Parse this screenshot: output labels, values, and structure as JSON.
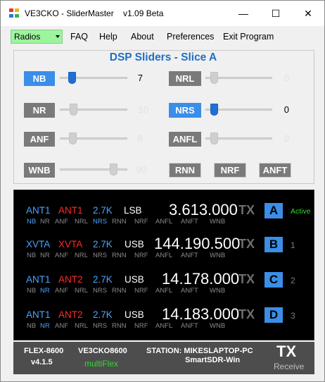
{
  "window": {
    "title": "VE3CKO - SliderMaster    v1.09 Beta",
    "minimize_glyph": "—",
    "maximize_glyph": "☐",
    "close_glyph": "✕"
  },
  "menu": {
    "radios_value": "Radios",
    "items": [
      "FAQ",
      "Help",
      "About",
      "Preferences",
      "Exit Program"
    ]
  },
  "dsp": {
    "title": "DSP Sliders - Slice A",
    "left": [
      {
        "label": "NB",
        "value": "7",
        "active": true,
        "level": 0.07
      },
      {
        "label": "NR",
        "value": "10",
        "active": false,
        "level": 0.1
      },
      {
        "label": "ANF",
        "value": "8",
        "active": false,
        "level": 0.08
      },
      {
        "label": "WNB",
        "value": "90",
        "active": false,
        "level": 0.9
      }
    ],
    "right": [
      {
        "label": "NRL",
        "value": "0",
        "active": false,
        "level": 0
      },
      {
        "label": "NRS",
        "value": "0",
        "active": true,
        "level": 0
      },
      {
        "label": "ANFL",
        "value": "0",
        "active": false,
        "level": 0
      }
    ],
    "extra_buttons": [
      "RNN",
      "NRF",
      "ANFT"
    ]
  },
  "slices": [
    {
      "ant_rx": "ANT1",
      "ant_tx": "ANT1",
      "bw": "2.7K",
      "mode": "LSB",
      "freq": "3.613.000",
      "tx": "TX",
      "letter": "A",
      "index": "",
      "status": "Active",
      "dsp_top": [
        "NB",
        "NR",
        "ANF",
        "NRL",
        "NRS",
        "RNN",
        "NRF",
        "ANFL",
        "ANFT",
        "WNB"
      ],
      "dsp_on": [
        0,
        4
      ]
    },
    {
      "ant_rx": "XVTA",
      "ant_tx": "XVTA",
      "bw": "2.7K",
      "mode": "USB",
      "freq": "144.190.500",
      "tx": "TX",
      "letter": "B",
      "index": "1",
      "status": "",
      "dsp_top": [
        "NB",
        "NR",
        "ANF",
        "NRL",
        "NRS",
        "RNN",
        "NRF",
        "ANFL",
        "ANFT",
        "WNB"
      ],
      "dsp_on": []
    },
    {
      "ant_rx": "ANT1",
      "ant_tx": "ANT2",
      "bw": "2.7K",
      "mode": "USB",
      "freq": "14.178.000",
      "tx": "TX",
      "letter": "C",
      "index": "2",
      "status": "",
      "dsp_top": [
        "NB",
        "NR",
        "ANF",
        "NRL",
        "NRS",
        "RNN",
        "NRF",
        "ANFL",
        "ANFT",
        "WNB"
      ],
      "dsp_on": [
        1
      ]
    },
    {
      "ant_rx": "ANT1",
      "ant_tx": "ANT2",
      "bw": "2.7K",
      "mode": "USB",
      "freq": "14.183.000",
      "tx": "TX",
      "letter": "D",
      "index": "3",
      "status": "",
      "dsp_top": [
        "NB",
        "NR",
        "ANF",
        "NRL",
        "NRS",
        "RNN",
        "NRF",
        "ANFL",
        "ANFT",
        "WNB"
      ],
      "dsp_on": [
        1
      ]
    }
  ],
  "status": {
    "model": "FLEX-8600",
    "version": "v4.1.5",
    "callsign": "VE3CKO8600",
    "multiflex": "multiFlex",
    "station": "STATION: MIKESLAPTOP-PC",
    "client": "SmartSDR-Win",
    "tx": "TX",
    "receive": "Receive"
  },
  "colors": {
    "accent": "#3a8ee8",
    "ant_rx": "#4aa3ff",
    "ant_tx": "#ff2b2b",
    "multiflex": "#2edb2e",
    "active": "#2edb2e"
  }
}
